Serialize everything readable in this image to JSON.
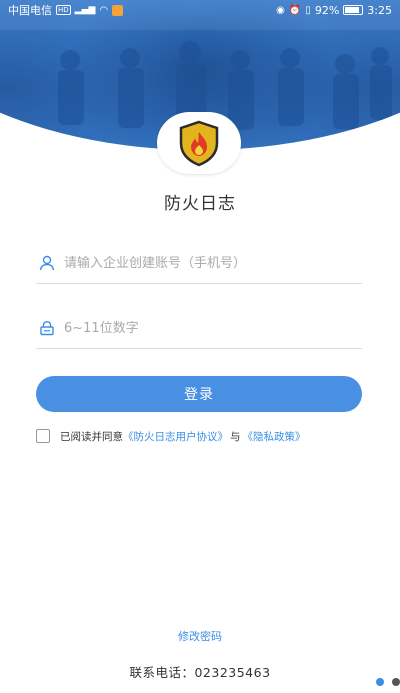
{
  "status_bar": {
    "carrier": "中国电信",
    "network_tag": "HD",
    "signal": "⁴ᴳ",
    "battery": "92%",
    "time": "3:25"
  },
  "app": {
    "title": "防火日志"
  },
  "login_form": {
    "account_placeholder": "请输入企业创建账号（手机号）",
    "password_placeholder": "6~11位数字",
    "login_label": "登录"
  },
  "agreement": {
    "prefix": "已阅读并同意",
    "user_agreement": "《防火日志用户协议》",
    "conjunction": "与",
    "privacy_policy": "《隐私政策》"
  },
  "footer": {
    "change_password": "修改密码",
    "contact_label": "联系电话：",
    "contact_phone": "023235463"
  },
  "colors": {
    "primary": "#4a90e2",
    "link": "#3a8ee6",
    "hero": "#3f86d8",
    "shield": "#e2b51f",
    "flame": "#e03b24"
  },
  "icons": {
    "account": "user-icon",
    "password": "lock-icon",
    "logo": "fire-shield-icon"
  }
}
